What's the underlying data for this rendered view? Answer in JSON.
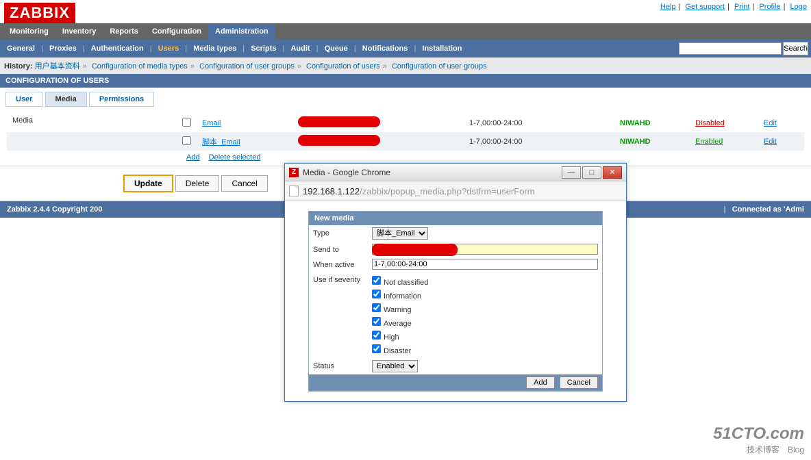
{
  "logo": "ZABBIX",
  "header_links": [
    "Help",
    "Get support",
    "Print",
    "Profile",
    "Logo"
  ],
  "nav1": [
    "Monitoring",
    "Inventory",
    "Reports",
    "Configuration",
    "Administration"
  ],
  "nav1_active": "Administration",
  "nav2": [
    "General",
    "Proxies",
    "Authentication",
    "Users",
    "Media types",
    "Scripts",
    "Audit",
    "Queue",
    "Notifications",
    "Installation"
  ],
  "nav2_active": "Users",
  "search_btn": "Search",
  "history": {
    "label": "History:",
    "items": [
      "用户基本资料",
      "Configuration of media types",
      "Configuration of user groups",
      "Configuration of users",
      "Configuration of user groups"
    ]
  },
  "section": "CONFIGURATION OF USERS",
  "tabs": [
    "User",
    "Media",
    "Permissions"
  ],
  "tabs_active": "Media",
  "media_label": "Media",
  "media_rows": [
    {
      "type": "Email",
      "when": "1-7,00:00-24:00",
      "severity": "NIWAHD",
      "status": "Disabled",
      "status_cls": "red-link",
      "edit": "Edit"
    },
    {
      "type": "脚本_Email",
      "when": "1-7,00:00-24:00",
      "severity": "NIWAHD",
      "status": "Enabled",
      "status_cls": "green-link",
      "edit": "Edit"
    }
  ],
  "add_link": "Add",
  "delete_selected": "Delete selected",
  "btn_update": "Update",
  "btn_delete": "Delete",
  "btn_cancel": "Cancel",
  "footer_left": "Zabbix 2.4.4 Copyright 200",
  "footer_right": "Connected as 'Admi",
  "popup": {
    "title": "Media - Google Chrome",
    "url_host": "192.168.1.122",
    "url_path": "/zabbix/popup_media.php?dstfrm=userForm",
    "form_title": "New media",
    "labels": {
      "type": "Type",
      "sendto": "Send to",
      "when": "When active",
      "severity": "Use if severity",
      "status": "Status"
    },
    "type_value": "脚本_Email",
    "when_value": "1-7,00:00-24:00",
    "severities": [
      "Not classified",
      "Information",
      "Warning",
      "Average",
      "High",
      "Disaster"
    ],
    "status_value": "Enabled",
    "btn_add": "Add",
    "btn_cancel": "Cancel"
  },
  "watermark": {
    "big": "51CTO.com",
    "small": "技术博客　Blog"
  }
}
